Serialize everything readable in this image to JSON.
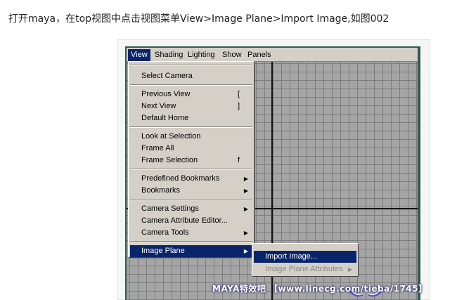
{
  "caption": "打开maya，在top视图中点击视图菜单View>Image Plane>Import Image,如图002",
  "menubar": {
    "items": [
      "View",
      "Shading",
      "Lighting",
      "Show",
      "Panels"
    ],
    "active": "View"
  },
  "view_menu": {
    "select_camera": "Select Camera",
    "previous_view": "Previous View",
    "previous_view_shortcut": "[",
    "next_view": "Next View",
    "next_view_shortcut": "]",
    "default_home": "Default Home",
    "look_at_selection": "Look at Selection",
    "frame_all": "Frame All",
    "frame_selection": "Frame Selection",
    "frame_selection_shortcut": "f",
    "predefined_bookmarks": "Predefined Bookmarks",
    "bookmarks": "Bookmarks",
    "camera_settings": "Camera Settings",
    "camera_attribute_editor": "Camera Attribute Editor...",
    "camera_tools": "Camera Tools",
    "image_plane": "Image Plane"
  },
  "image_plane_submenu": {
    "import_image": "Import Image...",
    "image_plane_attributes": "Image Plane Attributes"
  },
  "watermark": "MAYA特效吧 【www.linecg.com/tieba/1745】",
  "colors": {
    "menu_bg": "#d4d0c8",
    "highlight": "#0a246a",
    "viewport_bg": "#a5a5a5",
    "grid_line": "#7c7c7c",
    "frame_border": "#2f5a55"
  }
}
